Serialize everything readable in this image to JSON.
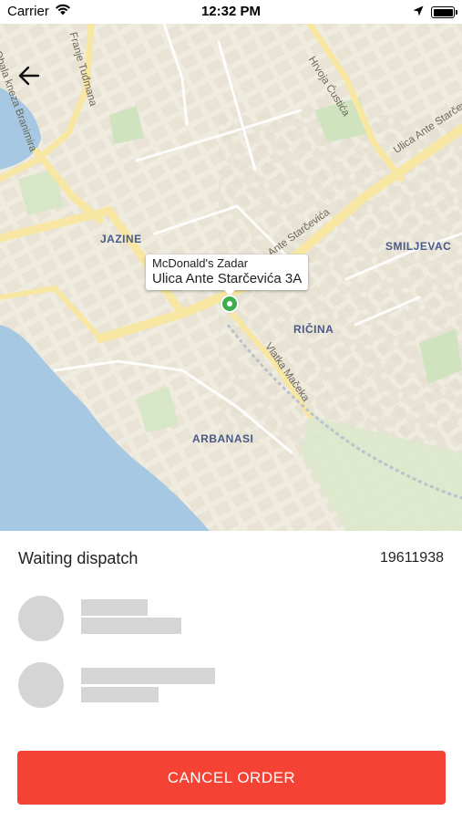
{
  "status_bar": {
    "carrier": "Carrier",
    "time": "12:32 PM"
  },
  "map": {
    "districts": {
      "jazine": "JAZINE",
      "smiljevac": "SMILJEVAC",
      "ricina": "RIČINA",
      "arbanasi": "ARBANASI"
    },
    "streets": {
      "obala_kneza_branimira": "Obala kneza Branimira",
      "franje_tudmana": "Franje Tuđmana",
      "hrvoja_custica": "Hrvoja Ćustića",
      "ulica_ante_starcevica": "Ulica Ante Starčevića",
      "ante_starcevica": "Ante Starčevića",
      "vlatka_maceka": "Vlatka Mačeka"
    },
    "callout": {
      "title": "McDonald's Zadar",
      "address": "Ulica Ante Starčevića 3A"
    }
  },
  "order": {
    "status": "Waiting dispatch",
    "number": "19611938"
  },
  "actions": {
    "cancel_label": "CANCEL ORDER"
  },
  "colors": {
    "accent": "#f44235",
    "pin": "#3cae4c",
    "water": "#a6c8e3",
    "road": "#f7e7a3",
    "skeleton": "#d5d5d5"
  }
}
